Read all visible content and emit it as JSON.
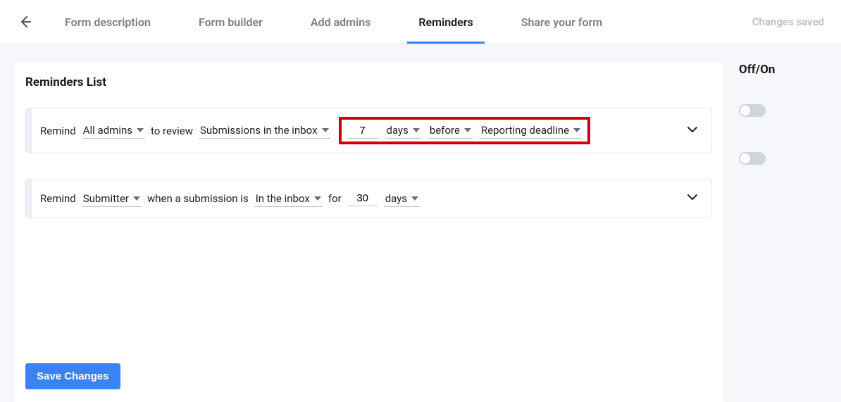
{
  "status": {
    "changes_saved": "Changes saved"
  },
  "tabs": [
    {
      "label": "Form description",
      "active": false
    },
    {
      "label": "Form builder",
      "active": false
    },
    {
      "label": "Add admins",
      "active": false
    },
    {
      "label": "Reminders",
      "active": true
    },
    {
      "label": "Share your form",
      "active": false
    }
  ],
  "panel": {
    "title": "Reminders List",
    "side_title": "Off/On",
    "save_label": "Save Changes"
  },
  "reminder1": {
    "remind": "Remind",
    "who": "All admins",
    "to_review": "to review",
    "target": "Submissions in the inbox",
    "number": "7",
    "unit": "days",
    "relation": "before",
    "event": "Reporting deadline"
  },
  "reminder2": {
    "remind": "Remind",
    "who": "Submitter",
    "when_a": "when a submission is",
    "state": "In the inbox",
    "for": "for",
    "number": "30",
    "unit": "days"
  }
}
